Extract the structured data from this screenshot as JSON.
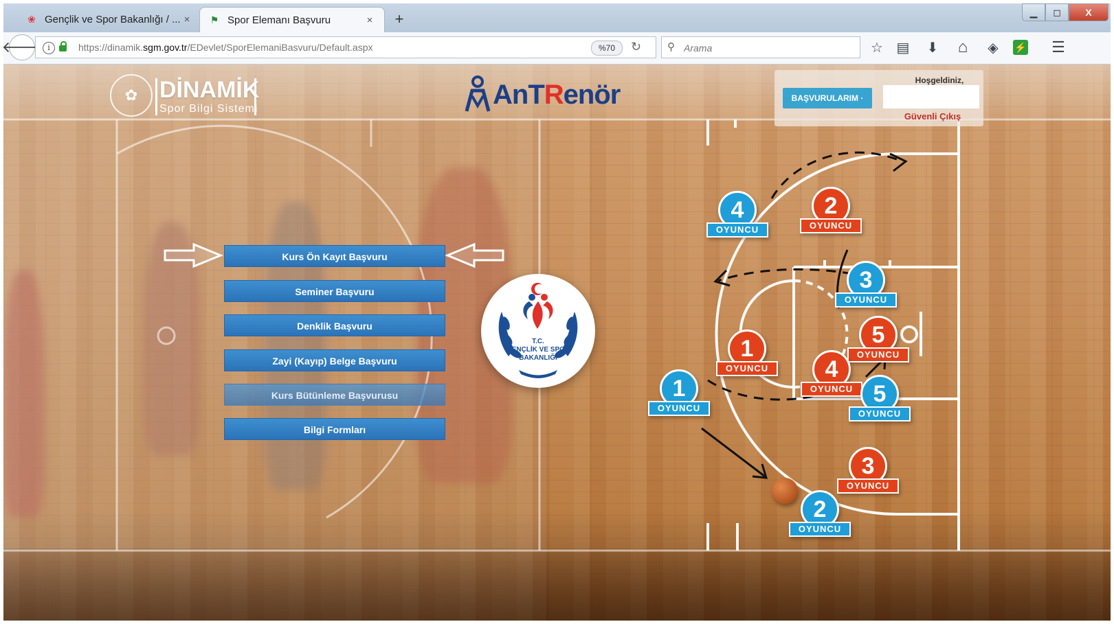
{
  "browser": {
    "tabs": [
      {
        "label": "Gençlik ve Spor Bakanlığı / ...",
        "active": false
      },
      {
        "label": "Spor Elemanı Başvuru",
        "active": true
      }
    ],
    "tab_close": "×",
    "new_tab": "+",
    "window_controls": {
      "minimize": "▁",
      "maximize": "◻",
      "close": "X"
    },
    "back": "🡐",
    "url_prefix": "https://dinamik.",
    "url_domain": "sgm.gov.tr",
    "url_path": "/EDevlet/SporElemaniBasvuru/Default.aspx",
    "zoom": "%70",
    "reload": "↻",
    "search_placeholder": "Arama",
    "toolbar_icons": {
      "bookmark": "☆",
      "reading_list": "▤",
      "download": "⬇",
      "home": "⌂",
      "pocket": "◈",
      "addon": "⚡",
      "menu": "☰"
    }
  },
  "header": {
    "dinamik_title": "DİNAMİK",
    "dinamik_subtitle": "Spor Bilgi Sistemi",
    "antrenor_part1": "AnT",
    "antrenor_part2": "R",
    "antrenor_part3": "enör",
    "basvurularim": "BAŞVURULARIM ·",
    "welcome": "Hoşgeldiniz,",
    "username": "",
    "logout": "Güvenli Çıkış"
  },
  "menu": [
    {
      "label": "Kurs Ön Kayıt Başvuru",
      "dim": false
    },
    {
      "label": "Seminer Başvuru",
      "dim": false
    },
    {
      "label": "Denklik Başvuru",
      "dim": false
    },
    {
      "label": "Zayi (Kayıp) Belge Başvuru",
      "dim": false
    },
    {
      "label": "Kurs Bütünleme Başvurusu",
      "dim": true
    },
    {
      "label": "Bilgi Formları",
      "dim": false
    }
  ],
  "ministry": {
    "line1": "T.C.",
    "line2": "GENÇLİK VE SPOR",
    "line3": "BAKANLIĞI"
  },
  "players": [
    {
      "number": "4",
      "label": "OYUNCU",
      "team": "blue"
    },
    {
      "number": "2",
      "label": "OYUNCU",
      "team": "red"
    },
    {
      "number": "3",
      "label": "OYUNCU",
      "team": "blue"
    },
    {
      "number": "1",
      "label": "OYUNCU",
      "team": "red"
    },
    {
      "number": "5",
      "label": "OYUNCU",
      "team": "red"
    },
    {
      "number": "4",
      "label": "OYUNCU",
      "team": "red"
    },
    {
      "number": "1",
      "label": "OYUNCU",
      "team": "blue"
    },
    {
      "number": "5",
      "label": "OYUNCU",
      "team": "blue"
    },
    {
      "number": "3",
      "label": "OYUNCU",
      "team": "red"
    },
    {
      "number": "2",
      "label": "OYUNCU",
      "team": "blue"
    }
  ],
  "colors": {
    "team_blue": "#1f9ed8",
    "team_red": "#e2421b",
    "menu_blue": "#2b73b8",
    "logout_red": "#c0312a"
  }
}
